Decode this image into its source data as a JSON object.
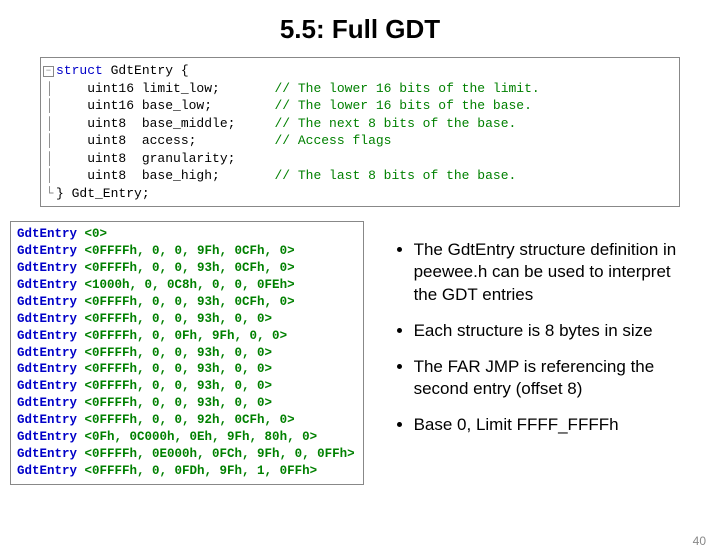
{
  "title": "5.5: Full GDT",
  "struct": {
    "open": "struct GdtEntry {",
    "fields": [
      {
        "decl": "uint16 limit_low;",
        "comment": "// The lower 16 bits of the limit."
      },
      {
        "decl": "uint16 base_low;",
        "comment": "// The lower 16 bits of the base."
      },
      {
        "decl": "uint8  base_middle;",
        "comment": "// The next 8 bits of the base."
      },
      {
        "decl": "uint8  access;",
        "comment": "// Access flags"
      },
      {
        "decl": "uint8  granularity;",
        "comment": ""
      },
      {
        "decl": "uint8  base_high;",
        "comment": "// The last 8 bits of the base."
      }
    ],
    "close": "} Gdt_Entry;"
  },
  "entries": [
    {
      "name": "GdtEntry",
      "vals": "<0>"
    },
    {
      "name": "GdtEntry",
      "vals": "<0FFFFh, 0, 0, 9Fh, 0CFh, 0>"
    },
    {
      "name": "GdtEntry",
      "vals": "<0FFFFh, 0, 0, 93h, 0CFh, 0>"
    },
    {
      "name": "GdtEntry",
      "vals": "<1000h, 0, 0C8h, 0, 0, 0FEh>"
    },
    {
      "name": "GdtEntry",
      "vals": "<0FFFFh, 0, 0, 93h, 0CFh, 0>"
    },
    {
      "name": "GdtEntry",
      "vals": "<0FFFFh, 0, 0, 93h, 0, 0>"
    },
    {
      "name": "GdtEntry",
      "vals": "<0FFFFh, 0, 0Fh, 9Fh, 0, 0>"
    },
    {
      "name": "GdtEntry",
      "vals": "<0FFFFh, 0, 0, 93h, 0, 0>"
    },
    {
      "name": "GdtEntry",
      "vals": "<0FFFFh, 0, 0, 93h, 0, 0>"
    },
    {
      "name": "GdtEntry",
      "vals": "<0FFFFh, 0, 0, 93h, 0, 0>"
    },
    {
      "name": "GdtEntry",
      "vals": "<0FFFFh, 0, 0, 93h, 0, 0>"
    },
    {
      "name": "GdtEntry",
      "vals": "<0FFFFh, 0, 0, 92h, 0CFh, 0>"
    },
    {
      "name": "GdtEntry",
      "vals": "<0Fh, 0C000h, 0Eh, 9Fh, 80h, 0>"
    },
    {
      "name": "GdtEntry",
      "vals": "<0FFFFh, 0E000h, 0FCh, 9Fh, 0, 0FFh>"
    },
    {
      "name": "GdtEntry",
      "vals": "<0FFFFh, 0, 0FDh, 9Fh, 1, 0FFh>"
    }
  ],
  "bullets": [
    "The GdtEntry structure definition in peewee.h can be used to interpret the GDT entries",
    "Each structure is 8 bytes in size",
    "The FAR JMP is referencing the second entry (offset 8)",
    "Base 0, Limit FFFF_FFFFh"
  ],
  "pagenum": "40"
}
